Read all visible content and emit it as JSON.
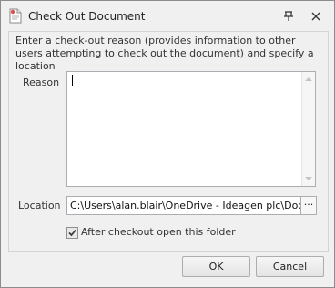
{
  "window": {
    "title": "Check Out Document",
    "app_icon": "document-icon",
    "pin_icon": "pin-icon",
    "close_icon": "close-icon"
  },
  "dialog": {
    "description": "Enter a check-out reason (provides information to other users attempting to check out the document) and  specify a location",
    "reason_label": "Reason",
    "reason_value": "",
    "location_label": "Location",
    "location_value": "C:\\Users\\alan.blair\\OneDrive - Ideagen plc\\Documen",
    "browse_label": "···",
    "open_folder_label": "After checkout open this folder",
    "open_folder_checked": true
  },
  "buttons": {
    "ok": "OK",
    "cancel": "Cancel"
  }
}
